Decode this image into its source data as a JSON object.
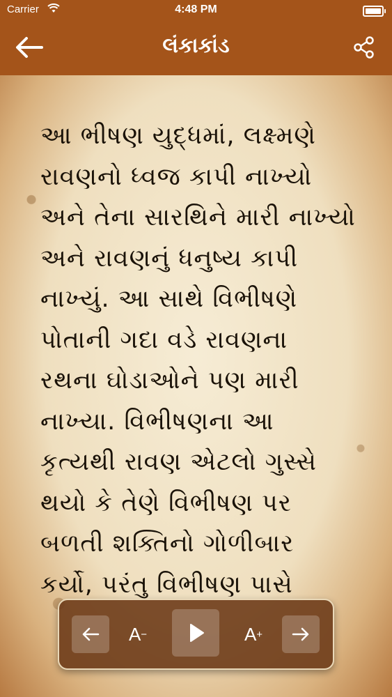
{
  "status_bar": {
    "carrier": "Carrier",
    "time": "4:48 PM"
  },
  "nav": {
    "title": "લંકાકાંડ",
    "back_icon": "arrow-left-icon",
    "share_icon": "share-icon"
  },
  "content": {
    "lines": [
      "આ ભીષણ યુદ્ધમાં, લક્ષ્મણે",
      "રાવણનો ધ્વજ કાપી નાખ્યો",
      "અને તેના સારથિને મારી નાખ્યો",
      "અને રાવણનું ધનુષ્ય કાપી",
      "નાખ્યું. આ સાથે વિભીષણે",
      "પોતાની ગદા વડે રાવણના",
      "રથના ઘોડાઓને પણ મારી",
      "નાખ્યા. વિભીષણના આ",
      "કૃત્યથી રાવણ એટલો ગુસ્સે",
      "થયો કે તેણે વિભીષણ પર",
      "બળતી શક્તિનો ગોળીબાર",
      "કર્યો, પરંતુ વિભીષણ પાસે"
    ]
  },
  "controls": {
    "prev_icon": "arrow-left-icon",
    "font_decrease_label": "A",
    "font_decrease_mark": "−",
    "play_icon": "play-icon",
    "font_increase_label": "A",
    "font_increase_mark": "+",
    "next_icon": "arrow-right-icon"
  },
  "colors": {
    "header": "#a4541a",
    "text": "#1a1208",
    "control_bg": "#6e3c19"
  }
}
